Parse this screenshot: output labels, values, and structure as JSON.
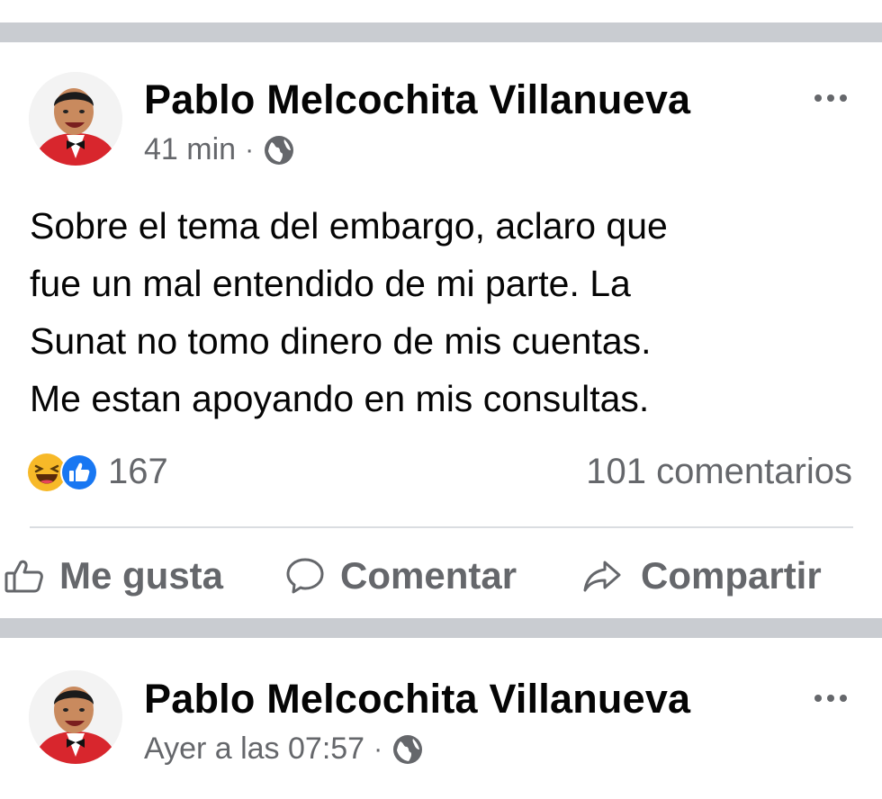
{
  "posts": [
    {
      "author": "Pablo Melcochita Villanueva",
      "time": "41 min",
      "separator": "·",
      "privacy_icon": "globe-icon",
      "text": "Sobre el tema del embargo, aclaro que\nfue un mal entendido de mi parte. La\nSunat no tomo dinero de mis cuentas.\nMe estan apoyando en mis consultas.",
      "reactions": {
        "icons": [
          "haha-icon",
          "like-icon"
        ],
        "count": "167"
      },
      "comments": "101 comentarios",
      "actions": {
        "like": "Me gusta",
        "comment": "Comentar",
        "share": "Compartir"
      }
    },
    {
      "author": "Pablo Melcochita Villanueva",
      "time": "Ayer a las 07:57",
      "separator": "·",
      "privacy_icon": "globe-icon"
    }
  ],
  "colors": {
    "divider": "#c9ccd1",
    "secondary_text": "#65676b",
    "primary_text": "#050505",
    "like_blue": "#1877f2",
    "haha_yellow": "#f7b928"
  }
}
